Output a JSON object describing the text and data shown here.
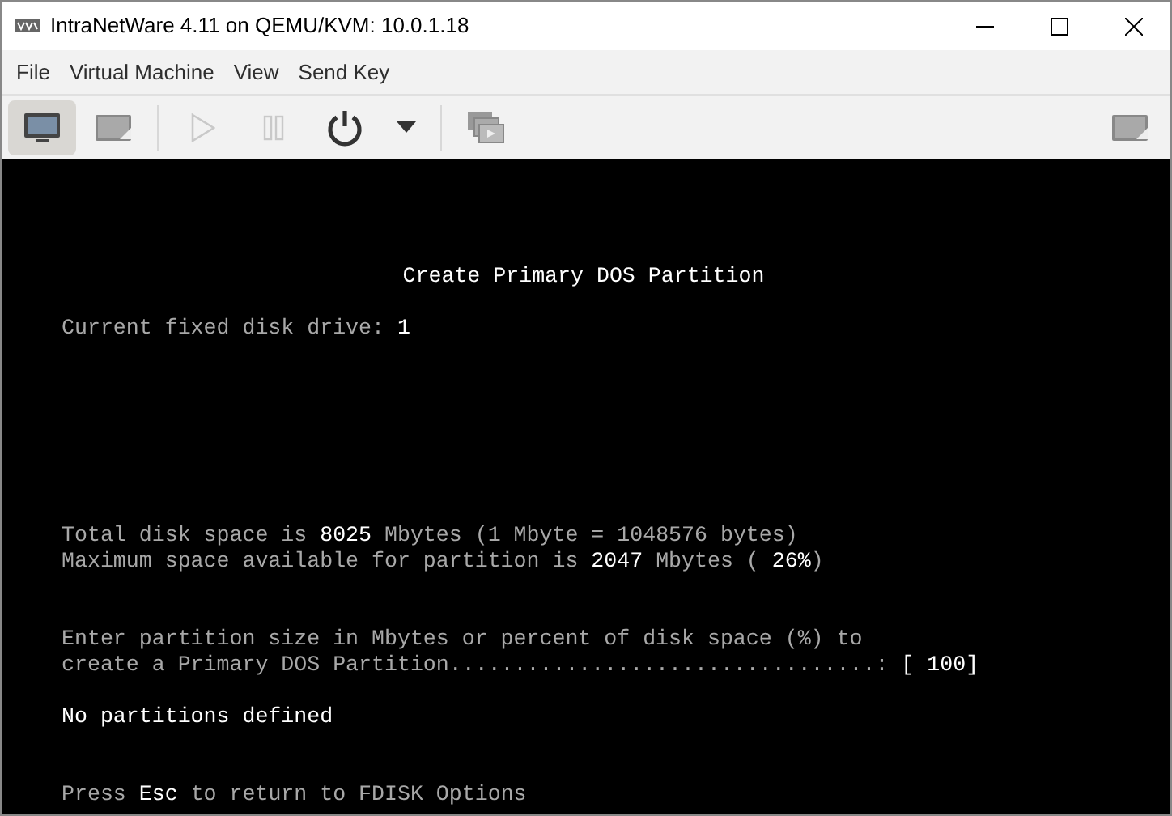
{
  "window": {
    "title": "IntraNetWare 4.11 on QEMU/KVM: 10.0.1.18"
  },
  "menu": [
    "File",
    "Virtual Machine",
    "View",
    "Send Key"
  ],
  "toolbar": [
    {
      "kind": "console",
      "selected": true,
      "disabled": false
    },
    {
      "kind": "details",
      "selected": false,
      "disabled": false
    },
    {
      "kind": "separator"
    },
    {
      "kind": "run",
      "selected": false,
      "disabled": true
    },
    {
      "kind": "pause",
      "selected": false,
      "disabled": true
    },
    {
      "kind": "power",
      "selected": false,
      "disabled": false
    },
    {
      "kind": "dropdown",
      "selected": false,
      "disabled": false
    },
    {
      "kind": "separator"
    },
    {
      "kind": "snapshots",
      "selected": false,
      "disabled": false
    },
    {
      "kind": "spacer"
    },
    {
      "kind": "fullscreen",
      "selected": false,
      "disabled": false
    }
  ],
  "console": {
    "lines": [
      {
        "kind": "blank"
      },
      {
        "kind": "blank"
      },
      {
        "kind": "blank"
      },
      {
        "kind": "blank"
      },
      {
        "kind": "title",
        "text": "Create Primary DOS Partition"
      },
      {
        "kind": "blank"
      },
      {
        "kind": "text",
        "text": "Current fixed disk drive: **1**"
      },
      {
        "kind": "blank"
      },
      {
        "kind": "blank"
      },
      {
        "kind": "blank"
      },
      {
        "kind": "blank"
      },
      {
        "kind": "blank"
      },
      {
        "kind": "blank"
      },
      {
        "kind": "blank"
      },
      {
        "kind": "text",
        "text": "Total disk space is **8025** Mbytes (1 Mbyte = 1048576 bytes)"
      },
      {
        "kind": "text",
        "text": "Maximum space available for partition is **2047** Mbytes ( **26%**)"
      },
      {
        "kind": "blank"
      },
      {
        "kind": "blank"
      },
      {
        "kind": "text",
        "text": "Enter partition size in Mbytes or percent of disk space (%) to"
      },
      {
        "kind": "text",
        "text": "create a Primary DOS Partition.................................: **[ 100]**"
      },
      {
        "kind": "blank"
      },
      {
        "kind": "bright",
        "text": "No partitions defined"
      },
      {
        "kind": "blank"
      },
      {
        "kind": "blank"
      },
      {
        "kind": "text",
        "text": "Press **Esc** to return to FDISK Options"
      }
    ]
  }
}
